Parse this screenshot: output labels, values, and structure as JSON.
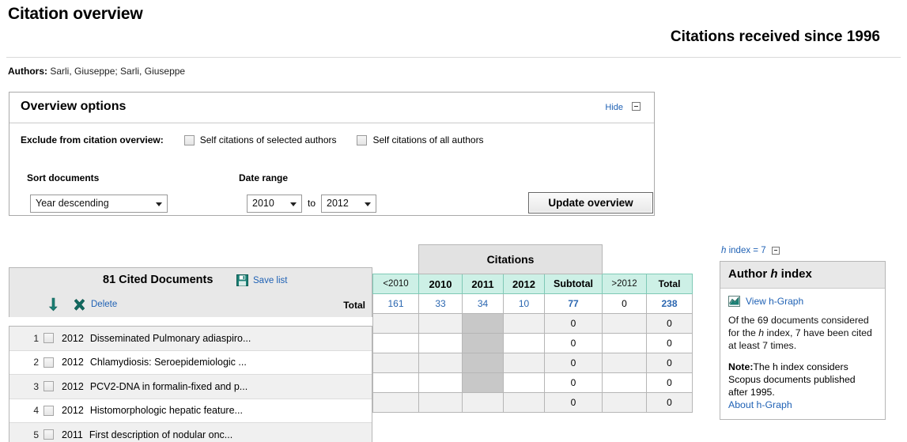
{
  "header": {
    "title": "Citation overview",
    "citations_since": "Citations received since 1996",
    "authors_label": "Authors:",
    "authors_value": "Sarli, Giuseppe; Sarli, Giuseppe"
  },
  "options": {
    "title": "Overview options",
    "hide_label": "Hide",
    "exclude_label": "Exclude from citation overview:",
    "checkbox_selected_authors": "Self citations of selected authors",
    "checkbox_all_authors": "Self citations of all authors",
    "sort_label": "Sort documents",
    "sort_value": "Year descending",
    "date_label": "Date range",
    "date_from": "2010",
    "date_to": "2012",
    "to_word": "to",
    "update_button": "Update overview"
  },
  "citations_table": {
    "title": "Citations",
    "columns": [
      "<2010",
      "2010",
      "2011",
      "2012",
      "Subtotal",
      ">2012",
      "Total"
    ],
    "totals": [
      "161",
      "33",
      "34",
      "10",
      "77",
      "0",
      "238"
    ],
    "highlighted_column": "2011"
  },
  "documents": {
    "count_label": "81 Cited Documents",
    "save_list_label": "Save list",
    "delete_label": "Delete",
    "total_label": "Total",
    "rows": [
      {
        "index": "1",
        "year": "2012",
        "title": "Disseminated Pulmonary adiaspiro...",
        "lt2010": "",
        "y2010": "",
        "y2011": "",
        "y2012": "",
        "subtotal": "0",
        "gt2012": "",
        "total": "0"
      },
      {
        "index": "2",
        "year": "2012",
        "title": "Chlamydiosis: Seroepidemiologic ...",
        "lt2010": "",
        "y2010": "",
        "y2011": "",
        "y2012": "",
        "subtotal": "0",
        "gt2012": "",
        "total": "0"
      },
      {
        "index": "3",
        "year": "2012",
        "title": "PCV2-DNA in formalin-fixed and p...",
        "lt2010": "",
        "y2010": "",
        "y2011": "",
        "y2012": "",
        "subtotal": "0",
        "gt2012": "",
        "total": "0"
      },
      {
        "index": "4",
        "year": "2012",
        "title": "Histomorphologic hepatic feature...",
        "lt2010": "",
        "y2010": "",
        "y2011": "",
        "y2012": "",
        "subtotal": "0",
        "gt2012": "",
        "total": "0"
      },
      {
        "index": "5",
        "year": "2011",
        "title": "First description of nodular onc...",
        "lt2010": "",
        "y2010": "",
        "y2011": "",
        "y2012": "",
        "subtotal": "0",
        "gt2012": "",
        "total": "0"
      }
    ]
  },
  "h_index": {
    "summary_prefix": "h",
    "summary_rest": " index = 7",
    "panel_title_pre": "Author ",
    "panel_title_ital": "h",
    "panel_title_post": " index",
    "view_graph_label": "View h-Graph",
    "body_part1": "Of the 69 documents considered for the ",
    "body_ital": "h",
    "body_part2": " index, 7 have been cited at least 7 times.",
    "note_label": "Note:",
    "note_part1": "The ",
    "note_ital": "h",
    "note_part2": " index considers Scopus documents published after 1995.",
    "about_label": "About h-Graph"
  },
  "colors": {
    "link": "#2062b5",
    "header_cyan": "#cdf0e6",
    "cyan_border": "#7fc9b6",
    "panel_gray": "#e8e8e8",
    "highlight_gray": "#c8c8c8",
    "teal_icon": "#137a6e"
  }
}
